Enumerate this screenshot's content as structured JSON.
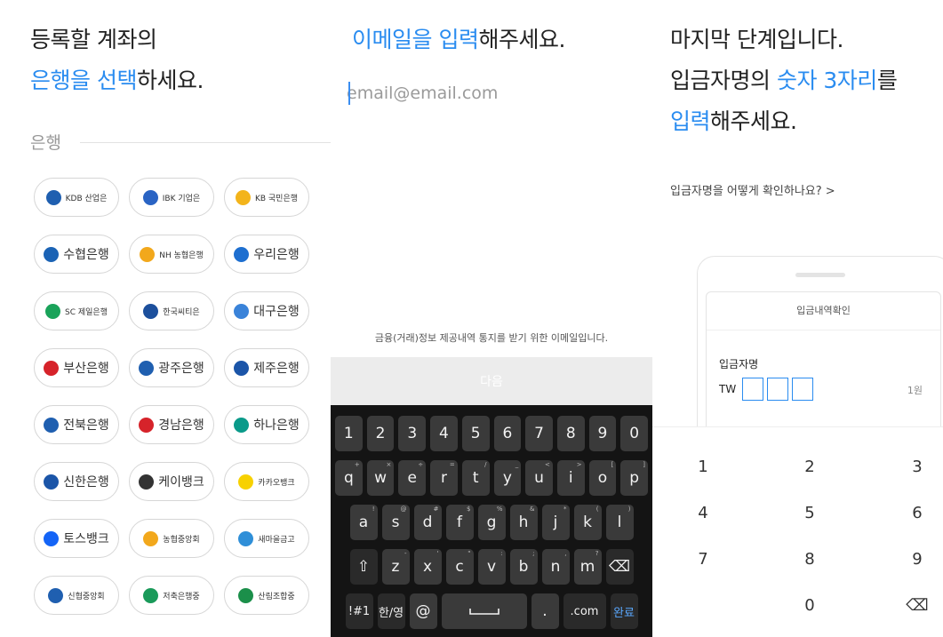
{
  "bank_step": {
    "title_line1": "등록할 계좌의",
    "title_hl": "은행을 선택",
    "title_rest": "하세요.",
    "section_label": "은행",
    "banks": [
      {
        "label": "KDB 산업은",
        "color": "#1f5fb0",
        "icon": "kdb-logo-icon",
        "size": "sm"
      },
      {
        "label": "IBK 기업은",
        "color": "#2a64c4",
        "icon": "ibk-logo-icon",
        "size": "sm"
      },
      {
        "label": "KB 국민은행",
        "color": "#f3b41b",
        "icon": "kb-logo-icon",
        "size": "sm"
      },
      {
        "label": "수협은행",
        "color": "#1b63b5",
        "icon": "suhyup-logo-icon",
        "size": "lg"
      },
      {
        "label": "NH 농협은행",
        "color": "#f2a81c",
        "icon": "nh-logo-icon",
        "size": "sm"
      },
      {
        "label": "우리은행",
        "color": "#1e6fd0",
        "icon": "woori-logo-icon",
        "size": "lg"
      },
      {
        "label": "SC 제일은행",
        "color": "#1aa35a",
        "icon": "sc-logo-icon",
        "size": "sm"
      },
      {
        "label": "한국씨티은",
        "color": "#1c4f9c",
        "icon": "citi-logo-icon",
        "size": "sm"
      },
      {
        "label": "대구은행",
        "color": "#3a83d9",
        "icon": "dgb-logo-icon",
        "size": "lg"
      },
      {
        "label": "부산은행",
        "color": "#d6232a",
        "icon": "bnk-logo-icon",
        "size": "lg"
      },
      {
        "label": "광주은행",
        "color": "#1f5fb0",
        "icon": "kjb-logo-icon",
        "size": "lg"
      },
      {
        "label": "제주은행",
        "color": "#1b55a8",
        "icon": "jeju-logo-icon",
        "size": "lg"
      },
      {
        "label": "전북은행",
        "color": "#1f5fb0",
        "icon": "jb-logo-icon",
        "size": "lg"
      },
      {
        "label": "경남은행",
        "color": "#d6232a",
        "icon": "knb-logo-icon",
        "size": "lg"
      },
      {
        "label": "하나은행",
        "color": "#0a9a8a",
        "icon": "hana-logo-icon",
        "size": "lg"
      },
      {
        "label": "신한은행",
        "color": "#1b55a8",
        "icon": "shinhan-logo-icon",
        "size": "lg"
      },
      {
        "label": "케이뱅크",
        "color": "#333333",
        "icon": "kbank-logo-icon",
        "size": "lg"
      },
      {
        "label": "카카오뱅크",
        "color": "#f7d100",
        "icon": "kakaobank-logo-icon",
        "size": "sm"
      },
      {
        "label": "토스뱅크",
        "color": "#1464f6",
        "icon": "toss-logo-icon",
        "size": "lg"
      },
      {
        "label": "농협중앙회",
        "color": "#f2a81c",
        "icon": "nonghyup-logo-icon",
        "size": "sm"
      },
      {
        "label": "새마을금고",
        "color": "#2f8fd8",
        "icon": "mg-logo-icon",
        "size": "sm"
      },
      {
        "label": "신협중앙회",
        "color": "#1f5fb0",
        "icon": "cu-logo-icon",
        "size": "sm"
      },
      {
        "label": "저축은행중",
        "color": "#1a9a5a",
        "icon": "sb-logo-icon",
        "size": "sm"
      },
      {
        "label": "산림조합중",
        "color": "#1b8f4a",
        "icon": "forest-logo-icon",
        "size": "sm"
      }
    ]
  },
  "email_step": {
    "title_hl": "이메일을 입력",
    "title_rest": "해주세요.",
    "placeholder": "email@email.com",
    "notice": "금융(거래)정보 제공내역 통지를 받기 위한 이메일입니다.",
    "next_label": "다음",
    "keyboard": {
      "row1": [
        "1",
        "2",
        "3",
        "4",
        "5",
        "6",
        "7",
        "8",
        "9",
        "0"
      ],
      "row2": [
        [
          "q",
          "+"
        ],
        [
          "w",
          "×"
        ],
        [
          "e",
          "÷"
        ],
        [
          "r",
          "="
        ],
        [
          "t",
          "/"
        ],
        [
          "y",
          "_"
        ],
        [
          "u",
          "<"
        ],
        [
          "i",
          ">"
        ],
        [
          "o",
          "["
        ],
        [
          "p",
          "]"
        ]
      ],
      "row3": [
        [
          "a",
          "!"
        ],
        [
          "s",
          "@"
        ],
        [
          "d",
          "#"
        ],
        [
          "f",
          "$"
        ],
        [
          "g",
          "%"
        ],
        [
          "h",
          "&"
        ],
        [
          "j",
          "*"
        ],
        [
          "k",
          "("
        ],
        [
          "l",
          ")"
        ]
      ],
      "row4": [
        [
          "z",
          "-"
        ],
        [
          "x",
          "'"
        ],
        [
          "c",
          "\""
        ],
        [
          "v",
          ":"
        ],
        [
          "b",
          ";"
        ],
        [
          "n",
          ","
        ],
        [
          "m",
          "?"
        ]
      ],
      "shift": "⇧",
      "backspace": "⌫",
      "symbols": "!#1",
      "lang": "한/영",
      "at": "@",
      "dot": ".",
      "com": ".com",
      "done": "완료",
      "accent": "#5aa8ff"
    }
  },
  "code_step": {
    "title_line1": "마지막 단계입니다.",
    "title_line2_pre": "입금자명의 ",
    "title_line2_hl": "숫자 3자리",
    "title_line2_post": "를",
    "title_line3_hl": "입력",
    "title_line3_rest": "해주세요.",
    "help_link": "입금자명을 어떻게 확인하나요? >",
    "card_title": "입금내역확인",
    "depositor_label": "입금자명",
    "depositor_prefix": "TW",
    "amount": "1원",
    "numpad": [
      "1",
      "2",
      "3",
      "4",
      "5",
      "6",
      "7",
      "8",
      "9",
      "0"
    ],
    "numpad_backspace": "⌫"
  }
}
